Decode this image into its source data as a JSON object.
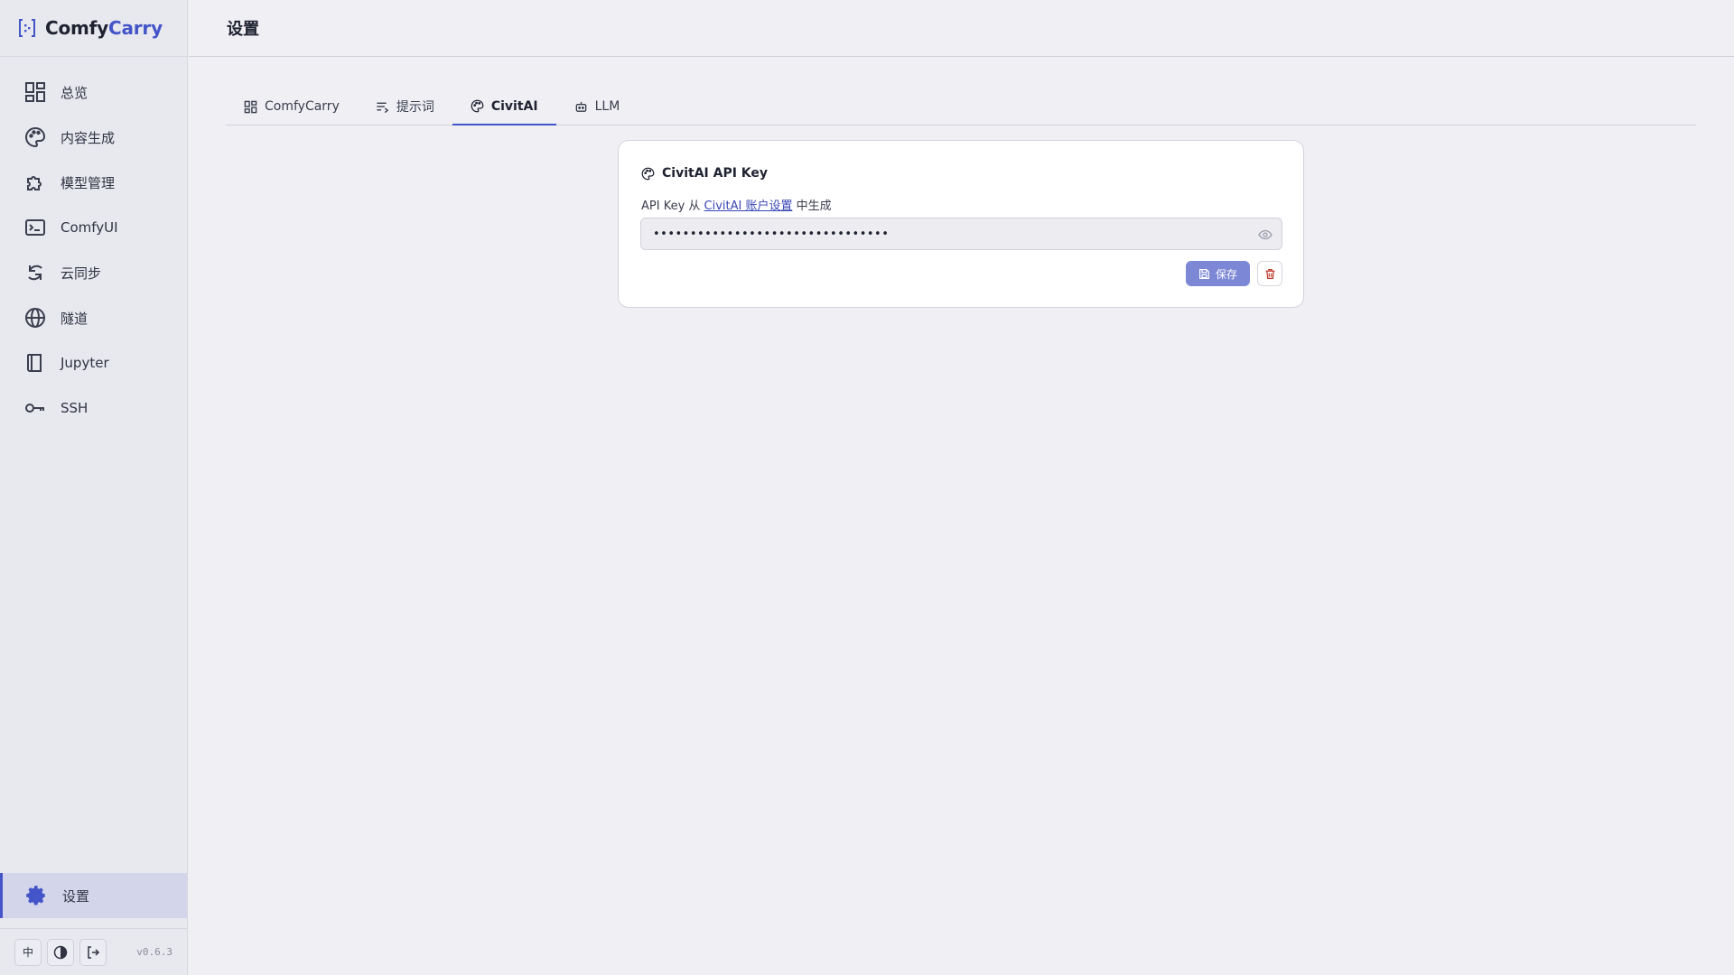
{
  "app": {
    "brand_part1": "Comfy",
    "brand_part2": "Carry",
    "version": "v0.6.3"
  },
  "sidebar": {
    "items": [
      {
        "label": "总览",
        "icon": "dashboard-icon"
      },
      {
        "label": "内容生成",
        "icon": "palette-icon"
      },
      {
        "label": "模型管理",
        "icon": "puzzle-icon"
      },
      {
        "label": "ComfyUI",
        "icon": "terminal-icon"
      },
      {
        "label": "云同步",
        "icon": "sync-icon"
      },
      {
        "label": "隧道",
        "icon": "globe-icon"
      },
      {
        "label": "Jupyter",
        "icon": "book-icon"
      },
      {
        "label": "SSH",
        "icon": "key-icon"
      }
    ],
    "settings_label": "设置",
    "footer": {
      "lang_label": "中"
    }
  },
  "header": {
    "title": "设置"
  },
  "tabs": [
    {
      "label": "ComfyCarry",
      "icon": "dashboard-icon"
    },
    {
      "label": "提示词",
      "icon": "text-icon"
    },
    {
      "label": "CivitAI",
      "icon": "palette-icon",
      "active": true
    },
    {
      "label": "LLM",
      "icon": "robot-icon"
    }
  ],
  "card": {
    "title": "CivitAI API Key",
    "desc_prefix": "API Key 从",
    "desc_link": "CivitAI 账户设置",
    "desc_suffix": "中生成",
    "key_value": "••••••••••••••••••••••••••••••••",
    "save_label": "保存"
  },
  "colors": {
    "accent": "#4355c9",
    "save_button": "#7c87d6",
    "delete_icon": "#c0392b"
  }
}
